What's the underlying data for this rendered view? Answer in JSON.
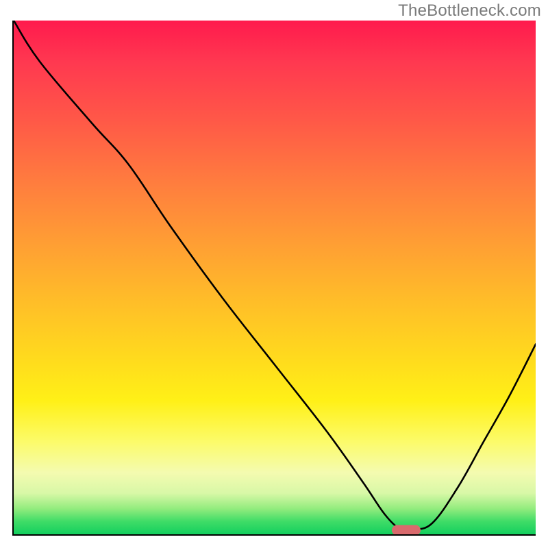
{
  "watermark": "TheBottleneck.com",
  "colors": {
    "axis": "#000000",
    "curve": "#000000",
    "marker": "#d96a6d",
    "watermark": "#7a7a7a"
  },
  "chart_data": {
    "type": "line",
    "title": "",
    "xlabel": "",
    "ylabel": "",
    "xlim": [
      0,
      100
    ],
    "ylim": [
      0,
      100
    ],
    "grid": false,
    "legend": false,
    "background": "rainbow-vertical-gradient (red→orange→yellow→green)",
    "series": [
      {
        "name": "bottleneck-curve",
        "x": [
          0,
          5,
          15,
          22,
          30,
          40,
          50,
          60,
          67,
          71,
          74,
          76,
          80,
          85,
          90,
          95,
          100
        ],
        "values": [
          100,
          92,
          80,
          72,
          60,
          46,
          33,
          20,
          10,
          4,
          1,
          1,
          2,
          9,
          18,
          27,
          37
        ]
      }
    ],
    "annotations": [
      {
        "name": "optimal-marker",
        "x": 75,
        "y": 1,
        "shape": "rounded-pill",
        "color": "#d96a6d"
      }
    ],
    "notes": "No axis tick labels or numeric labels are visible; values are estimated from curve shape relative to plot bounds."
  }
}
